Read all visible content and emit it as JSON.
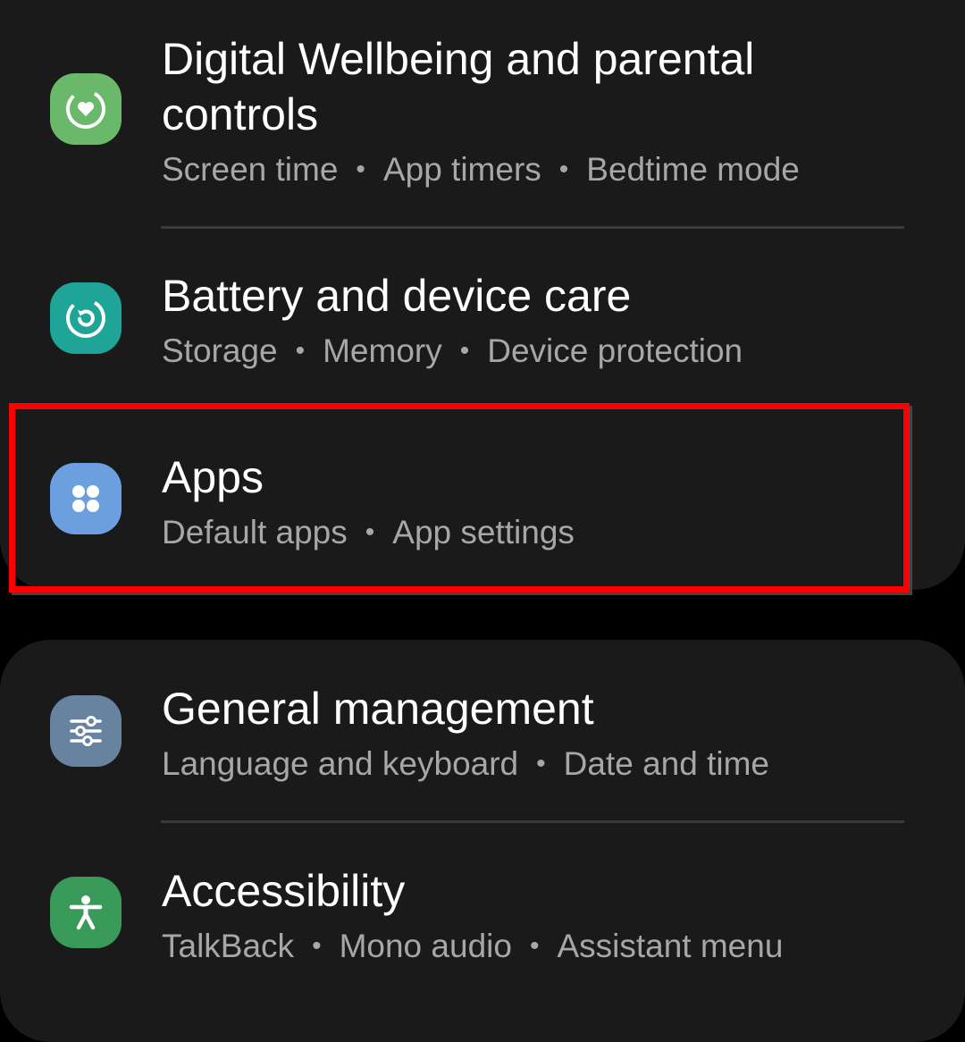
{
  "settings": {
    "items": [
      {
        "title": "Digital Wellbeing and parental controls",
        "subtitle_parts": [
          "Screen time",
          "App timers",
          "Bedtime mode"
        ],
        "icon": "digital-wellbeing-icon",
        "icon_color": "#6ab96a"
      },
      {
        "title": "Battery and device care",
        "subtitle_parts": [
          "Storage",
          "Memory",
          "Device protection"
        ],
        "icon": "device-care-icon",
        "icon_color": "#1fa597"
      },
      {
        "title": "Apps",
        "subtitle_parts": [
          "Default apps",
          "App settings"
        ],
        "icon": "apps-icon",
        "icon_color": "#6b9fe0",
        "highlighted": true
      },
      {
        "title": "General management",
        "subtitle_parts": [
          "Language and keyboard",
          "Date and time"
        ],
        "icon": "general-management-icon",
        "icon_color": "#6883a0"
      },
      {
        "title": "Accessibility",
        "subtitle_parts": [
          "TalkBack",
          "Mono audio",
          "Assistant menu"
        ],
        "icon": "accessibility-icon",
        "icon_color": "#3a9a5a"
      }
    ]
  },
  "colors": {
    "background": "#000000",
    "card": "#1a1a1a",
    "title_text": "#ffffff",
    "subtitle_text": "#a7a7a7",
    "highlight_border": "#ff0000"
  }
}
